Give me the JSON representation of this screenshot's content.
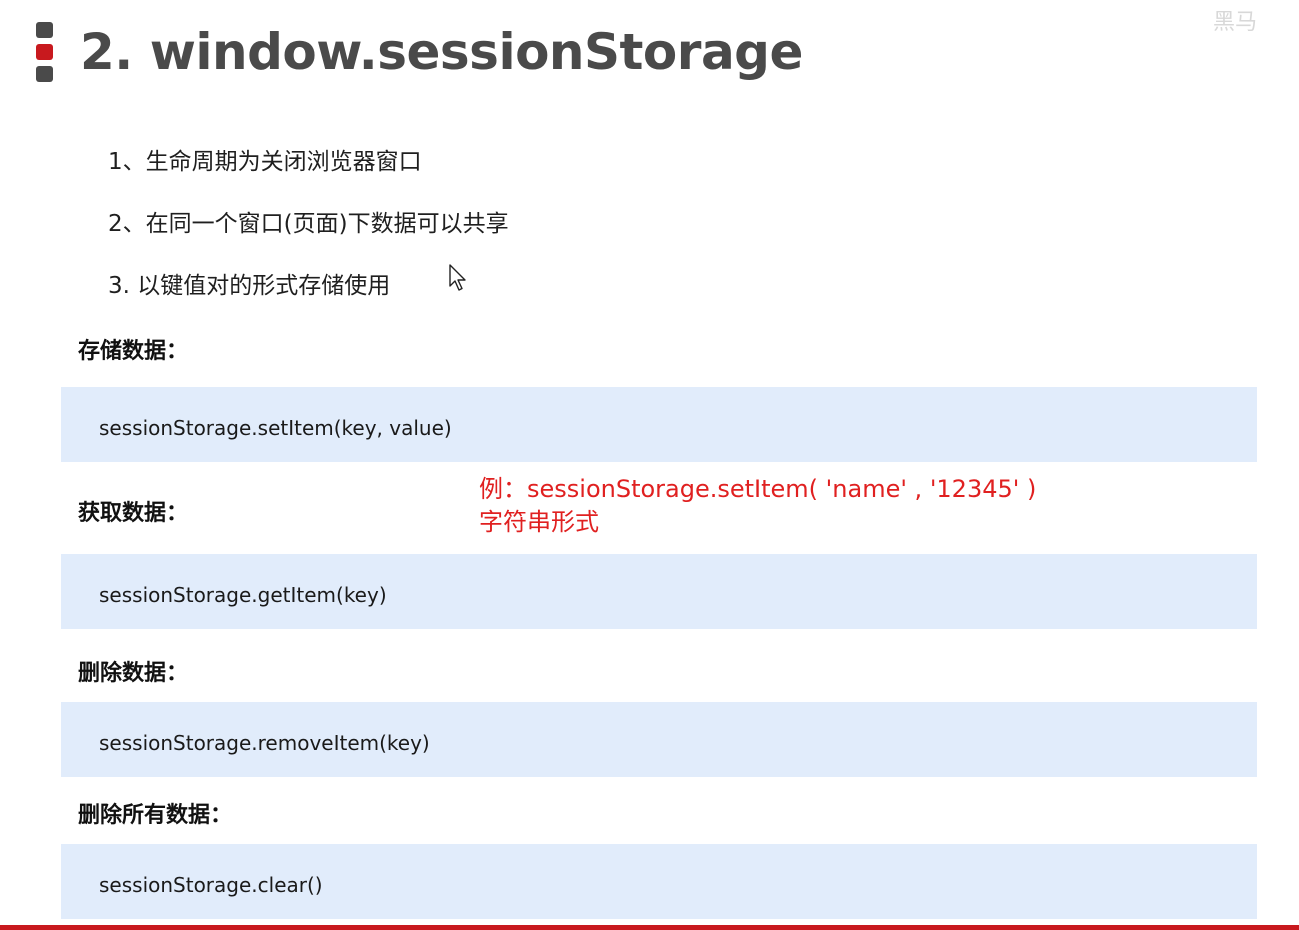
{
  "slide": {
    "title": "2. window.sessionStorage",
    "logo_text": "黑马"
  },
  "points": [
    "1、生命周期为关闭浏览器窗口",
    "2、在同一个窗口(页面)下数据可以共享",
    "3.  以键值对的形式存储使用"
  ],
  "sections": [
    {
      "label": "存储数据：",
      "code": "sessionStorage.setItem(key, value)"
    },
    {
      "label": "获取数据：",
      "code": "sessionStorage.getItem(key)"
    },
    {
      "label": "删除数据：",
      "code": "sessionStorage.removeItem(key)"
    },
    {
      "label": "删除所有数据：",
      "code": "sessionStorage.clear()"
    }
  ],
  "annotation": {
    "line1": "例：sessionStorage.setItem( 'name' , '12345' )",
    "line2": "字符串形式"
  },
  "colors": {
    "accent_red": "#c8191e",
    "title_gray": "#4a4a4a",
    "code_bg": "#e1ecfb",
    "annotation_red": "#e02020"
  },
  "icons": {
    "title_marker": "three-square-bullets-icon",
    "cursor": "mouse-pointer-icon"
  }
}
